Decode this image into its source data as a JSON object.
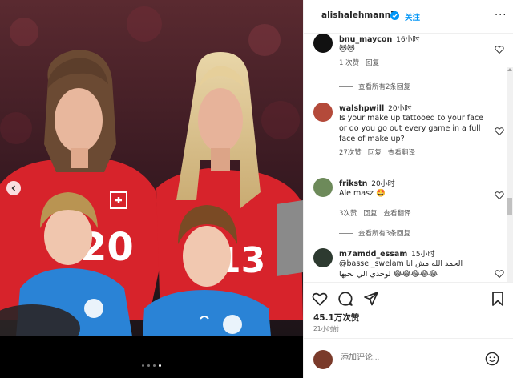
{
  "post": {
    "image_description": "",
    "image_dots": 4,
    "active_dot": 3
  },
  "header": {
    "username": "alishalehmann7",
    "follow_label": "关注",
    "more_label": "···"
  },
  "comments": [
    {
      "username": "bnu_maycon",
      "time": "16小时",
      "text": "😻😻",
      "meta": [
        "1 次赞",
        "回复"
      ],
      "view_replies": "查看所有2条回复"
    },
    {
      "username": "walshpwill",
      "time": "20小时",
      "text": "Is your make up tattooed to your face or do you go out every game in a full face of make up?",
      "meta": [
        "27次赞",
        "回复",
        "查看翻译"
      ]
    },
    {
      "username": "frikstn",
      "time": "20小时",
      "text": "Ale masz 🤩",
      "meta": [
        "3次赞",
        "回复",
        "查看翻译"
      ],
      "view_replies": "查看所有3条回复"
    },
    {
      "username": "m7amdd_essam",
      "time": "15小时",
      "text_line1": "@bassel_swelam الحمد الله مش انا",
      "text_line2": "لوحدي الي بحبها 😂😂😂😂😂"
    }
  ],
  "actions": {
    "likes": "45.1万次赞",
    "post_time": "21小时前"
  },
  "composer": {
    "placeholder": "添加评论..."
  },
  "colors": {
    "link_blue": "#0095f6",
    "jersey_red": "#d7232b",
    "kid_blue": "#2a83d6"
  }
}
